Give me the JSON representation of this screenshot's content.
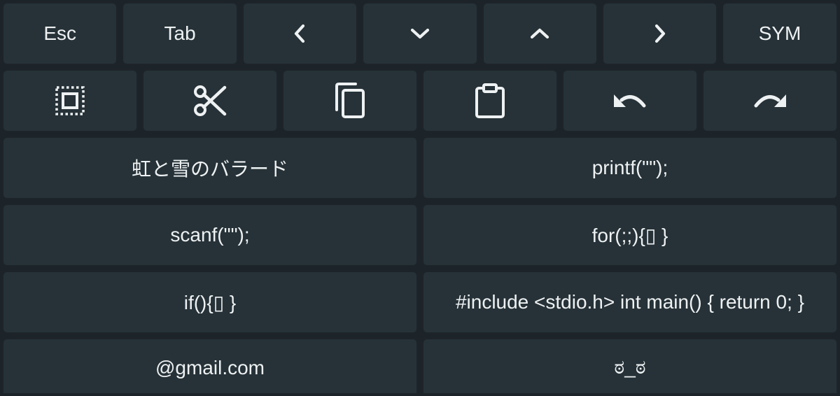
{
  "keyboard": {
    "row1": [
      {
        "label": "Esc"
      },
      {
        "label": "Tab"
      },
      {
        "label": "",
        "icon": "chevron-left-icon"
      },
      {
        "label": "",
        "icon": "chevron-down-icon"
      },
      {
        "label": "",
        "icon": "chevron-up-icon"
      },
      {
        "label": "",
        "icon": "chevron-right-icon"
      },
      {
        "label": "SYM"
      }
    ],
    "row2": [
      {
        "icon": "select-all-icon"
      },
      {
        "icon": "cut-icon"
      },
      {
        "icon": "copy-icon"
      },
      {
        "icon": "paste-icon"
      },
      {
        "icon": "undo-icon"
      },
      {
        "icon": "redo-icon"
      }
    ],
    "snippets": [
      "虹と雪のバラード",
      "printf(\"\");",
      "scanf(\"\");",
      "for(;;){▯ }",
      "if(){▯ }",
      "#include <stdio.h> int main() { return 0; }",
      "@gmail.com",
      "ಠ_ಠ"
    ]
  },
  "colors": {
    "background": "#1d2429",
    "key": "#263238",
    "text": "#eef1f2"
  }
}
